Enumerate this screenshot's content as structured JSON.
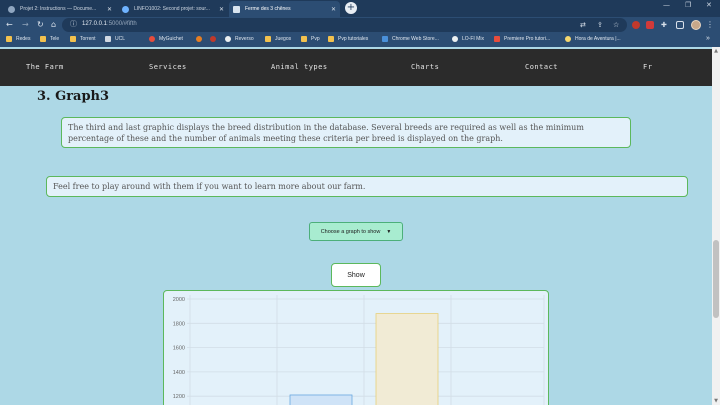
{
  "browser": {
    "tabs": [
      {
        "title": "Projet 2: Instructions — Docume...",
        "active": false
      },
      {
        "title": "LINFO1002: Second projet: sour...",
        "active": false
      },
      {
        "title": "Ferme des 3 chênes",
        "active": true
      }
    ],
    "new_tab": "+",
    "url_host": "127.0.0.1",
    "url_rest": ":5000/#fifth",
    "bookmarks": [
      "Redes",
      "Tele",
      "Torrent",
      "UCL",
      "MyGuichet",
      "Reverso",
      "Juegos",
      "Pvp",
      "Pvp tutoriales",
      "Chrome Web Store...",
      "LO-FI Mix",
      "Premiere Pro tutori...",
      "Hora de Aventura |..."
    ],
    "bookmarks_more": "»"
  },
  "nav": {
    "items": [
      "The Farm",
      "Services",
      "Animal types",
      "Charts",
      "Contact",
      "Fr"
    ]
  },
  "section": {
    "heading": "3. Graph3",
    "description": "The third and last graphic displays the breed distribution in the database. Several breeds are required as well as the minimum percentage of these and the number of animals meeting these criteria per breed is displayed on the graph.",
    "invite": "Feel free to play around with them if you want to learn more about our farm."
  },
  "controls": {
    "select_value": "Choose a graph to show",
    "show_label": "Show"
  },
  "chart_data": {
    "type": "bar",
    "y_ticks": [
      "2000",
      "1800",
      "1600",
      "1400",
      "1200"
    ],
    "ylim": [
      1200,
      2000
    ],
    "series": [
      {
        "values": [
          1210,
          1880
        ],
        "colors": [
          "#cfe3f7",
          "#f1ebd5"
        ],
        "borders": [
          "#6aa8e0",
          "#e8cf7a"
        ]
      }
    ]
  }
}
